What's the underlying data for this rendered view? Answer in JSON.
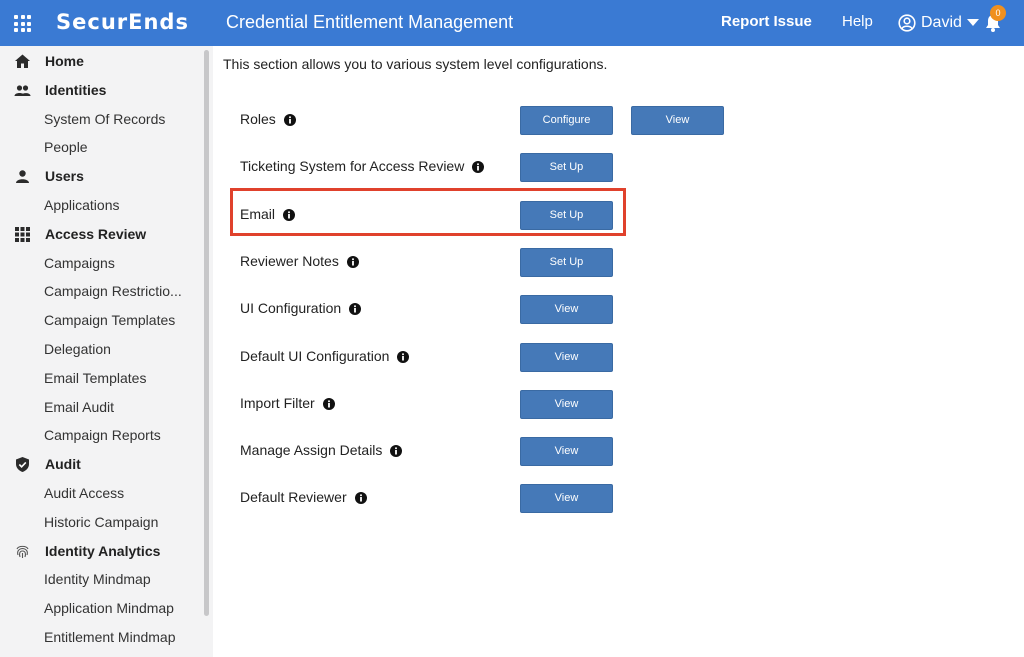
{
  "topbar": {
    "logo": "SecurEnds",
    "app_title": "Credential Entitlement Management",
    "report_issue": "Report Issue",
    "help": "Help",
    "user_name": "David",
    "notification_count": "0",
    "colors": {
      "bar": "#3a7ad3",
      "badge": "#f0901e"
    }
  },
  "sidebar": {
    "items": [
      {
        "label": "Home",
        "type": "section",
        "icon": "home-icon"
      },
      {
        "label": "Identities",
        "type": "section",
        "icon": "people-icon"
      },
      {
        "label": "System Of Records",
        "type": "child"
      },
      {
        "label": "People",
        "type": "child"
      },
      {
        "label": "Users",
        "type": "section",
        "icon": "user-icon"
      },
      {
        "label": "Applications",
        "type": "child"
      },
      {
        "label": "Access Review",
        "type": "section",
        "icon": "grid-icon"
      },
      {
        "label": "Campaigns",
        "type": "child"
      },
      {
        "label": "Campaign Restrictio...",
        "type": "child"
      },
      {
        "label": "Campaign Templates",
        "type": "child"
      },
      {
        "label": "Delegation",
        "type": "child"
      },
      {
        "label": "Email Templates",
        "type": "child"
      },
      {
        "label": "Email Audit",
        "type": "child"
      },
      {
        "label": "Campaign Reports",
        "type": "child"
      },
      {
        "label": "Audit",
        "type": "section",
        "icon": "shield-icon"
      },
      {
        "label": "Audit Access",
        "type": "child"
      },
      {
        "label": "Historic Campaign",
        "type": "child"
      },
      {
        "label": "Identity Analytics",
        "type": "section",
        "icon": "fingerprint-icon"
      },
      {
        "label": "Identity Mindmap",
        "type": "child"
      },
      {
        "label": "Application Mindmap",
        "type": "child"
      },
      {
        "label": "Entitlement Mindmap",
        "type": "child"
      }
    ]
  },
  "main": {
    "intro": "This section allows you to various system level configurations.",
    "rows": [
      {
        "label": "Roles",
        "buttons": [
          "Configure",
          "View"
        ]
      },
      {
        "label": "Ticketing System for Access Review",
        "buttons": [
          "Set Up"
        ]
      },
      {
        "label": "Email",
        "buttons": [
          "Set Up"
        ]
      },
      {
        "label": "Reviewer Notes",
        "buttons": [
          "Set Up"
        ]
      },
      {
        "label": "UI Configuration",
        "buttons": [
          "View"
        ]
      },
      {
        "label": "Default UI Configuration",
        "buttons": [
          "View"
        ]
      },
      {
        "label": "Import Filter",
        "buttons": [
          "View"
        ]
      },
      {
        "label": "Manage Assign Details",
        "buttons": [
          "View"
        ]
      },
      {
        "label": "Default Reviewer",
        "buttons": [
          "View"
        ]
      }
    ],
    "highlight_color": "#e0412c",
    "button_color": "#4579b8"
  }
}
